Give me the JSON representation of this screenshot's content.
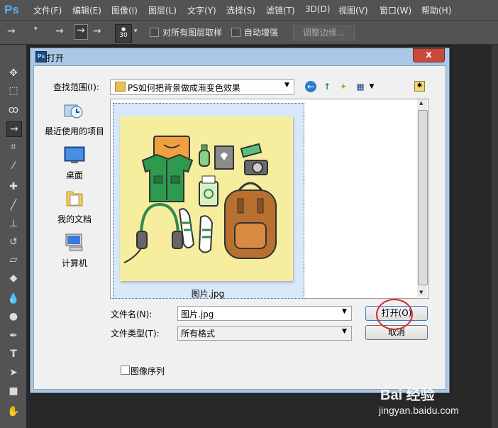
{
  "app": {
    "logo": "Ps",
    "menu": [
      "文件(F)",
      "编辑(E)",
      "图像(I)",
      "图层(L)",
      "文字(Y)",
      "选择(S)",
      "滤镜(T)",
      "3D(D)",
      "视图(V)",
      "窗口(W)",
      "帮助(H)"
    ]
  },
  "options": {
    "brush_size": "30",
    "sample_all_label": "对所有图层取样",
    "auto_enhance_label": "自动增强",
    "refine_edge_label": "调整边缘..."
  },
  "toolbox": {
    "icons": [
      "move-tool-icon",
      "marquee-tool-icon",
      "lasso-tool-icon",
      "quick-selection-tool-icon",
      "crop-tool-icon",
      "eyedropper-tool-icon",
      "healing-brush-tool-icon",
      "brush-tool-icon",
      "clone-stamp-tool-icon",
      "history-brush-tool-icon",
      "eraser-tool-icon",
      "paint-bucket-tool-icon",
      "dodge-tool-icon",
      "pen-tool-icon",
      "type-tool-icon",
      "path-selection-tool-icon",
      "shape-tool-icon",
      "hand-tool-icon"
    ]
  },
  "dialog": {
    "ps_icon": "Ps",
    "title": "打开",
    "close": "x",
    "look_in_label": "查找范围(I):",
    "look_in_value": "PS如何把背景做成渐变色效果",
    "places": [
      {
        "label": "最近使用的项目",
        "icon": "recent-items-icon"
      },
      {
        "label": "桌面",
        "icon": "desktop-icon"
      },
      {
        "label": "我的文档",
        "icon": "my-documents-icon"
      },
      {
        "label": "计算机",
        "icon": "computer-icon"
      }
    ],
    "file": {
      "name": "图片.jpg"
    },
    "file_name_label": "文件名(N):",
    "file_name_value": "图片.jpg",
    "file_type_label": "文件类型(T):",
    "file_type_value": "所有格式",
    "open_button": "打开(O)",
    "cancel_button": "取消",
    "image_sequence_label": "图像序列",
    "image_sequence_checked": false
  },
  "watermark": {
    "logo": "Bai 经验",
    "url": "jingyan.baidu.com"
  },
  "colors": {
    "highlight_circle": "#d42a2a",
    "thumbnail_background": "#f6ed9e",
    "dialog_frame": "#a9c8e8"
  }
}
